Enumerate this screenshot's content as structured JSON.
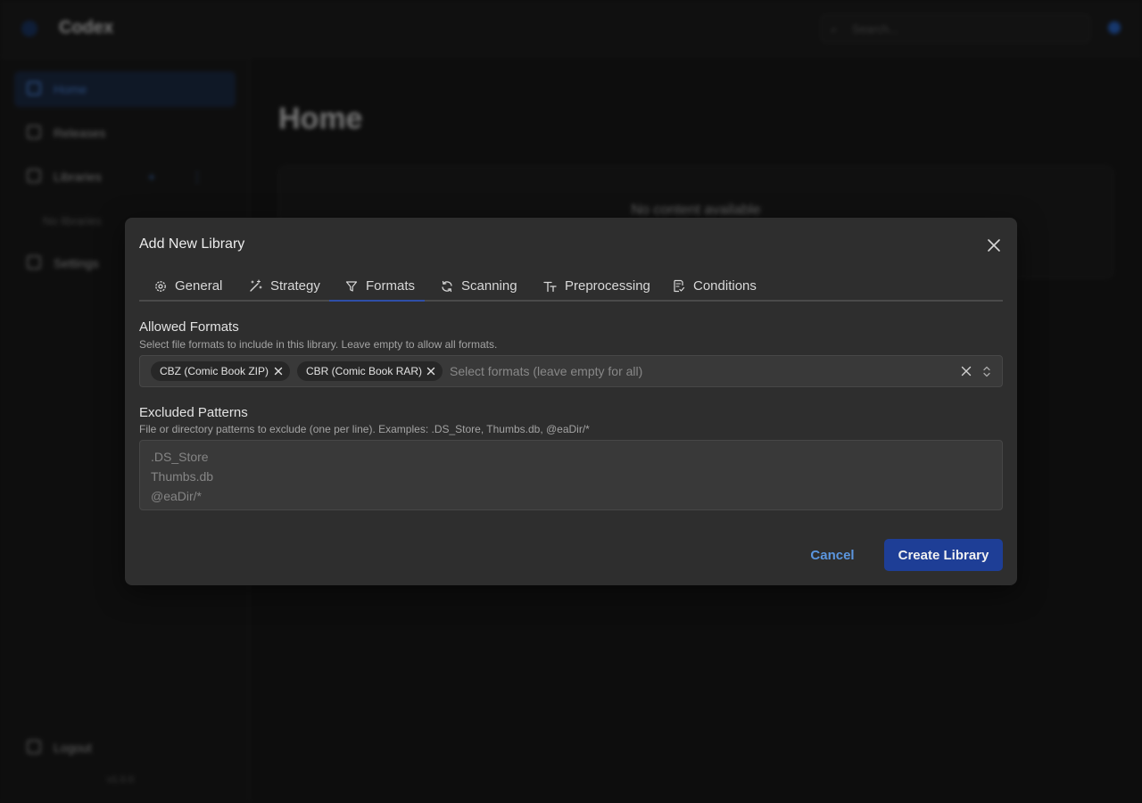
{
  "app": {
    "brand": "Codex",
    "search_placeholder": "Search...",
    "sidebar": {
      "items": [
        {
          "label": "Home",
          "icon": "home-icon"
        },
        {
          "label": "Releases",
          "icon": "releases-icon"
        },
        {
          "label": "Libraries",
          "icon": "library-icon"
        },
        {
          "label": "Settings",
          "icon": "gear-icon"
        }
      ],
      "libraries_actions": "+ ⋮",
      "no_libraries": "No libraries",
      "logout": "Logout",
      "version": "v1.0.0"
    },
    "main": {
      "title": "Home",
      "empty_message": "No content available"
    }
  },
  "modal": {
    "title": "Add New Library",
    "tabs": [
      {
        "label": "General",
        "icon": "gear-icon"
      },
      {
        "label": "Strategy",
        "icon": "magic-wand-icon"
      },
      {
        "label": "Formats",
        "icon": "filter-icon",
        "active": true
      },
      {
        "label": "Scanning",
        "icon": "refresh-icon"
      },
      {
        "label": "Preprocessing",
        "icon": "text-transform-icon"
      },
      {
        "label": "Conditions",
        "icon": "checklist-icon"
      }
    ],
    "allowed_formats": {
      "label": "Allowed Formats",
      "help": "Select file formats to include in this library. Leave empty to allow all formats.",
      "selected": [
        "CBZ (Comic Book ZIP)",
        "CBR (Comic Book RAR)"
      ],
      "placeholder": "Select formats (leave empty for all)"
    },
    "excluded_patterns": {
      "label": "Excluded Patterns",
      "help": "File or directory patterns to exclude (one per line). Examples: .DS_Store, Thumbs.db, @eaDir/*",
      "placeholder_lines": [
        ".DS_Store",
        "Thumbs.db",
        "@eaDir/*"
      ]
    },
    "buttons": {
      "cancel": "Cancel",
      "create": "Create Library"
    },
    "colors": {
      "accent": "#1e3e96",
      "link": "#5b96df",
      "tab_underline": "#2f4fa7"
    }
  }
}
